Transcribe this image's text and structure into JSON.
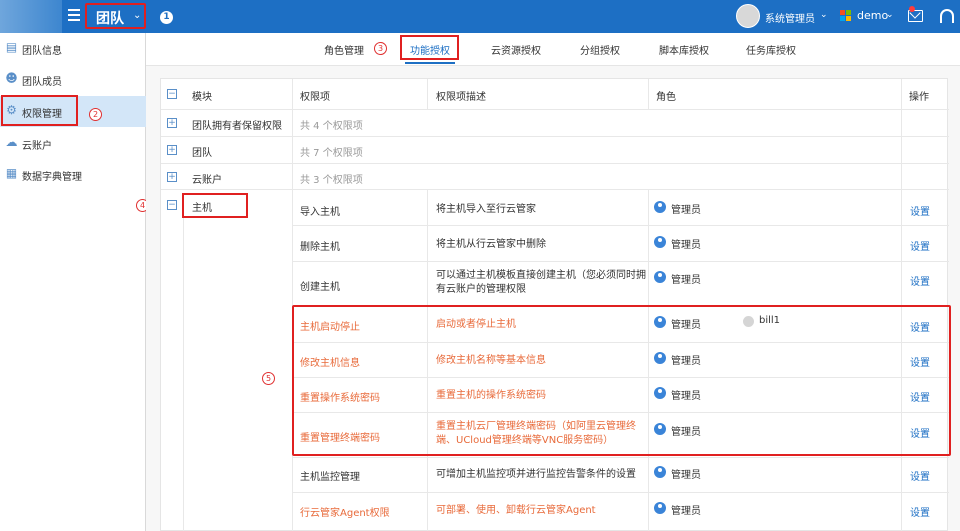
{
  "topbar": {
    "team_label": "团队",
    "step1": "1",
    "user_name": "系统管理员",
    "org_name": "demo",
    "colors": {
      "bar": "#1d6fc4",
      "highlight_box": "#e02020",
      "accent_text": "#e86a3a"
    }
  },
  "sidebar": {
    "items": [
      {
        "label": "团队信息",
        "icon": "info-icon"
      },
      {
        "label": "团队成员",
        "icon": "members-icon"
      },
      {
        "label": "权限管理",
        "icon": "permission-icon"
      },
      {
        "label": "云账户",
        "icon": "cloud-icon"
      },
      {
        "label": "数据字典管理",
        "icon": "dictionary-icon"
      }
    ],
    "step2": "2",
    "step4": "4"
  },
  "tabs": {
    "items": [
      "角色管理",
      "功能授权",
      "云资源授权",
      "分组授权",
      "脚本库授权",
      "任务库授权"
    ],
    "active": "功能授权",
    "step3": "3"
  },
  "table": {
    "headers": {
      "module": "模块",
      "perm": "权限项",
      "desc": "权限项描述",
      "role": "角色",
      "op": "操作"
    },
    "groups": [
      {
        "module": "团队拥有者保留权限",
        "count": "共 4 个权限项"
      },
      {
        "module": "团队",
        "count": "共 7 个权限项"
      },
      {
        "module": "云账户",
        "count": "共 3 个权限项"
      }
    ],
    "host_module": "主机",
    "step5": "5",
    "op_label": "设置",
    "role_admin": "管理员",
    "role_bill": "bill1",
    "rows": [
      {
        "perm": "导入主机",
        "desc": "将主机导入至行云管家"
      },
      {
        "perm": "删除主机",
        "desc": "将主机从行云管家中删除"
      },
      {
        "perm": "创建主机",
        "desc": "可以通过主机模板直接创建主机（您必须同时拥有云账户的管理权限"
      },
      {
        "perm": "主机启动停止",
        "desc": "启动或者停止主机"
      },
      {
        "perm": "修改主机信息",
        "desc": "修改主机名称等基本信息"
      },
      {
        "perm": "重置操作系统密码",
        "desc": "重置主机的操作系统密码"
      },
      {
        "perm": "重置管理终端密码",
        "desc": "重置主机云厂管理终端密码（如阿里云管理终端、UCloud管理终端等VNC服务密码）"
      },
      {
        "perm": "主机监控管理",
        "desc": "可增加主机监控项并进行监控告警条件的设置"
      },
      {
        "perm": "行云管家Agent权限",
        "desc": "可部署、使用、卸载行云管家Agent"
      }
    ]
  }
}
